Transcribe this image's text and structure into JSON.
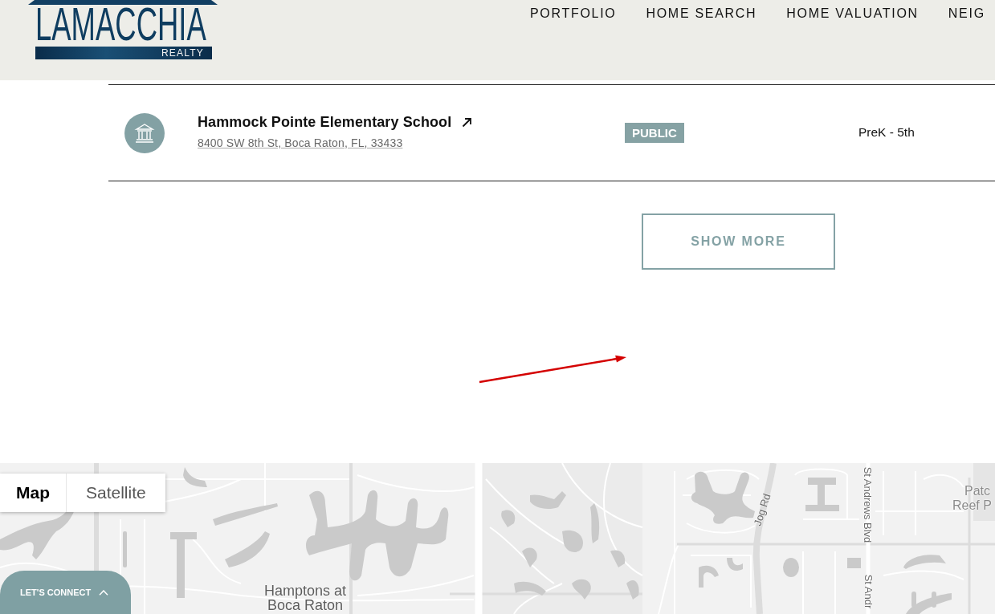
{
  "header": {
    "logo": {
      "wordmark": "LAMACCHIA",
      "tagline": "REALTY"
    },
    "nav": [
      "PORTFOLIO",
      "HOME SEARCH",
      "HOME VALUATION",
      "NEIG"
    ]
  },
  "schools": [
    {
      "name": "Hammock Pointe Elementary School",
      "address": "8400 SW 8th St, Boca Raton, FL, 33433",
      "type": "PUBLIC",
      "grades": "PreK - 5th"
    }
  ],
  "show_more": "SHOW MORE",
  "map": {
    "map_types": [
      {
        "label": "Map",
        "selected": true
      },
      {
        "label": "Satellite",
        "selected": false
      }
    ],
    "labels": [
      "Hamptons at Boca Raton",
      "Jog Rd",
      "St Andrews Blvd",
      "St Andr",
      "Patc",
      "Reef P"
    ]
  },
  "chat_button": "LET'S CONNECT"
}
